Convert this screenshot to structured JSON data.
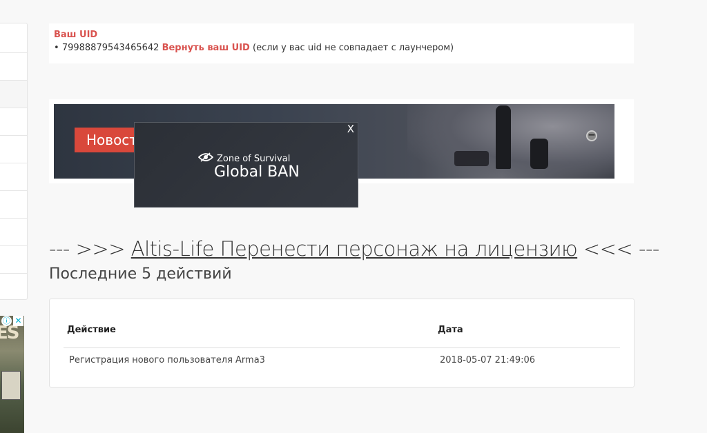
{
  "uid": {
    "title": "Ваш UID",
    "bullet_prefix": "• ",
    "value": "79988879543465642",
    "restore_link": "Вернуть ваш UID",
    "note": "(если у вас uid не совпадает с лаунчером)"
  },
  "banner": {
    "news_button": "Новости",
    "minus_icon": "minus-circle-icon"
  },
  "popup": {
    "close": "X",
    "brand": "Zone of Survival",
    "title": "Global BAN",
    "logo_icon": "eye-logo-icon"
  },
  "heading": {
    "prefix": "--- >>> ",
    "link": "Altis-Life Перенести персонаж на лицензию",
    "suffix": " <<< ---"
  },
  "subheading": "Последние 5 действий",
  "table": {
    "columns": [
      "Действие",
      "Дата"
    ],
    "rows": [
      [
        "Регистрация нового пользователя Arma3",
        "2018-05-07 21:49:06"
      ]
    ]
  },
  "side_ad": {
    "info_icon": "ⓘ",
    "close_icon": "✕",
    "letters": "ES"
  },
  "colors": {
    "accent_red": "#d9534f",
    "background": "#f8f8f8"
  }
}
